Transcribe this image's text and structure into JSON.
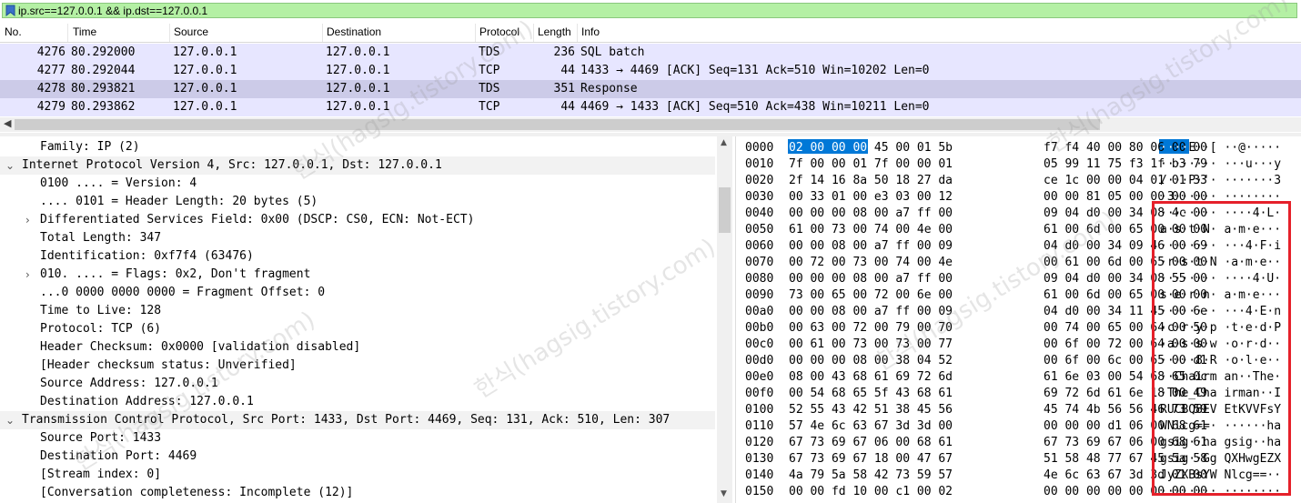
{
  "filter": {
    "icon": "bookmark-icon",
    "value": "ip.src==127.0.0.1 && ip.dst==127.0.0.1",
    "bg_color": "#b4f0a4"
  },
  "packet_list": {
    "columns": [
      "No.",
      "Time",
      "Source",
      "Destination",
      "Protocol",
      "Length",
      "Info"
    ],
    "rows": [
      {
        "no": "4276",
        "time": "80.292000",
        "source": "127.0.0.1",
        "destination": "127.0.0.1",
        "protocol": "TDS",
        "length": "236",
        "info": "SQL batch"
      },
      {
        "no": "4277",
        "time": "80.292044",
        "source": "127.0.0.1",
        "destination": "127.0.0.1",
        "protocol": "TCP",
        "length": "44",
        "info": "1433 → 4469 [ACK] Seq=131 Ack=510 Win=10202 Len=0"
      },
      {
        "no": "4278",
        "time": "80.293821",
        "source": "127.0.0.1",
        "destination": "127.0.0.1",
        "protocol": "TDS",
        "length": "351",
        "info": "Response"
      },
      {
        "no": "4279",
        "time": "80.293862",
        "source": "127.0.0.1",
        "destination": "127.0.0.1",
        "protocol": "TCP",
        "length": "44",
        "info": "4469 → 1433 [ACK] Seq=510 Ack=438 Win=10211 Len=0"
      }
    ],
    "selected_row_color": "#cccbe8",
    "row_color": "#e7e6ff"
  },
  "details": {
    "lines": [
      {
        "expander": "",
        "text": "Family: IP (2)"
      },
      {
        "expander": "v",
        "text": "Internet Protocol Version 4, Src: 127.0.0.1, Dst: 127.0.0.1"
      },
      {
        "expander": "",
        "text": "0100 .... = Version: 4"
      },
      {
        "expander": "",
        "text": ".... 0101 = Header Length: 20 bytes (5)"
      },
      {
        "expander": ">",
        "text": "Differentiated Services Field: 0x00 (DSCP: CS0, ECN: Not-ECT)"
      },
      {
        "expander": "",
        "text": "Total Length: 347"
      },
      {
        "expander": "",
        "text": "Identification: 0xf7f4 (63476)"
      },
      {
        "expander": ">",
        "text": "010. .... = Flags: 0x2, Don't fragment"
      },
      {
        "expander": "",
        "text": "...0 0000 0000 0000 = Fragment Offset: 0"
      },
      {
        "expander": "",
        "text": "Time to Live: 128"
      },
      {
        "expander": "",
        "text": "Protocol: TCP (6)"
      },
      {
        "expander": "",
        "text": "Header Checksum: 0x0000 [validation disabled]"
      },
      {
        "expander": "",
        "text": "[Header checksum status: Unverified]"
      },
      {
        "expander": "",
        "text": "Source Address: 127.0.0.1"
      },
      {
        "expander": "",
        "text": "Destination Address: 127.0.0.1"
      },
      {
        "expander": "v",
        "text": "Transmission Control Protocol, Src Port: 1433, Dst Port: 4469, Seq: 131, Ack: 510, Len: 307"
      },
      {
        "expander": "",
        "text": "Source Port: 1433"
      },
      {
        "expander": "",
        "text": "Destination Port: 4469"
      },
      {
        "expander": "",
        "text": "[Stream index: 0]"
      },
      {
        "expander": "",
        "text": "[Conversation completeness: Incomplete (12)]"
      }
    ]
  },
  "hex": {
    "rows": [
      {
        "offset": "0000",
        "h1": "02 00 00 00 45 00 01 5b",
        "h2": "f7 f4 40 00 80 06 00 00",
        "ascii": "····E··[ ··@·····"
      },
      {
        "offset": "0010",
        "h1": "7f 00 00 01 7f 00 00 01",
        "h2": "05 99 11 75 f3 1f b3 79",
        "ascii": "········ ···u···y"
      },
      {
        "offset": "0020",
        "h1": "2f 14 16 8a 50 18 27 da",
        "h2": "ce 1c 00 00 04 01 01 33",
        "ascii": "/···P·'· ·······3"
      },
      {
        "offset": "0030",
        "h1": "00 33 01 00 e3 03 00 12",
        "h2": "00 00 81 05 00 00 00 00",
        "ascii": "·3······ ········"
      },
      {
        "offset": "0040",
        "h1": "00 00 00 08 00 a7 ff 00",
        "h2": "09 04 d0 00 34 08 4c 00",
        "ascii": "········ ····4·L·"
      },
      {
        "offset": "0050",
        "h1": "61 00 73 00 74 00 4e 00",
        "h2": "61 00 6d 00 65 00 00 00",
        "ascii": "a·s·t·N· a·m·e···"
      },
      {
        "offset": "0060",
        "h1": "00 00 08 00 a7 ff 00 09",
        "h2": "04 d0 00 34 09 46 00 69",
        "ascii": "········ ···4·F·i"
      },
      {
        "offset": "0070",
        "h1": "00 72 00 73 00 74 00 4e",
        "h2": "00 61 00 6d 00 65 00 00",
        "ascii": "·r·s·t·N ·a·m·e··"
      },
      {
        "offset": "0080",
        "h1": "00 00 00 08 00 a7 ff 00",
        "h2": "09 04 d0 00 34 08 55 00",
        "ascii": "········ ····4·U·"
      },
      {
        "offset": "0090",
        "h1": "73 00 65 00 72 00 6e 00",
        "h2": "61 00 6d 00 65 00 00 00",
        "ascii": "s·e·r·n· a·m·e···"
      },
      {
        "offset": "00a0",
        "h1": "00 00 08 00 a7 ff 00 09",
        "h2": "04 d0 00 34 11 45 00 6e",
        "ascii": "········ ···4·E·n"
      },
      {
        "offset": "00b0",
        "h1": "00 63 00 72 00 79 00 70",
        "h2": "00 74 00 65 00 64 00 50",
        "ascii": "·c·r·y·p ·t·e·d·P"
      },
      {
        "offset": "00c0",
        "h1": "00 61 00 73 00 73 00 77",
        "h2": "00 6f 00 72 00 64 00 00",
        "ascii": "·a·s·s·w ·o·r·d··"
      },
      {
        "offset": "00d0",
        "h1": "00 00 00 08 00 38 04 52",
        "h2": "00 6f 00 6c 00 65 00 d1",
        "ascii": "·····8·R ·o·l·e··"
      },
      {
        "offset": "00e0",
        "h1": "08 00 43 68 61 69 72 6d",
        "h2": "61 6e 03 00 54 68 65 0c",
        "ascii": "··Chairm an··The·"
      },
      {
        "offset": "00f0",
        "h1": "00 54 68 65 5f 43 68 61",
        "h2": "69 72 6d 61 6e 18 00 49",
        "ascii": "·The_Cha irman··I"
      },
      {
        "offset": "0100",
        "h1": "52 55 43 42 51 38 45 56",
        "h2": "45 74 4b 56 56 46 73 59",
        "ascii": "RUCBQ8EV EtKVVFsY"
      },
      {
        "offset": "0110",
        "h1": "57 4e 6c 63 67 3d 3d 00",
        "h2": "00 00 00 d1 06 00 68 61",
        "ascii": "WNlcg==· ······ha"
      },
      {
        "offset": "0120",
        "h1": "67 73 69 67 06 00 68 61",
        "h2": "67 73 69 67 06 00 68 61",
        "ascii": "gsig··ha gsig··ha"
      },
      {
        "offset": "0130",
        "h1": "67 73 69 67 18 00 47 67",
        "h2": "51 58 48 77 67 45 5a 58",
        "ascii": "gsig··Gg QXHwgEZX"
      },
      {
        "offset": "0140",
        "h1": "4a 79 5a 58 42 73 59 57",
        "h2": "4e 6c 63 67 3d 3d 01 00",
        "ascii": "JyZXBsYW Nlcg==··"
      },
      {
        "offset": "0150",
        "h1": "00 00 fd 10 00 c1 00 02",
        "h2": "00 00 00 00 00 00 00 00",
        "ascii": "········ ········"
      }
    ]
  },
  "highlight_color": "#0078d7",
  "annotation_color": "#e5202a",
  "watermark": "한식(hagsig.tistory.com)"
}
